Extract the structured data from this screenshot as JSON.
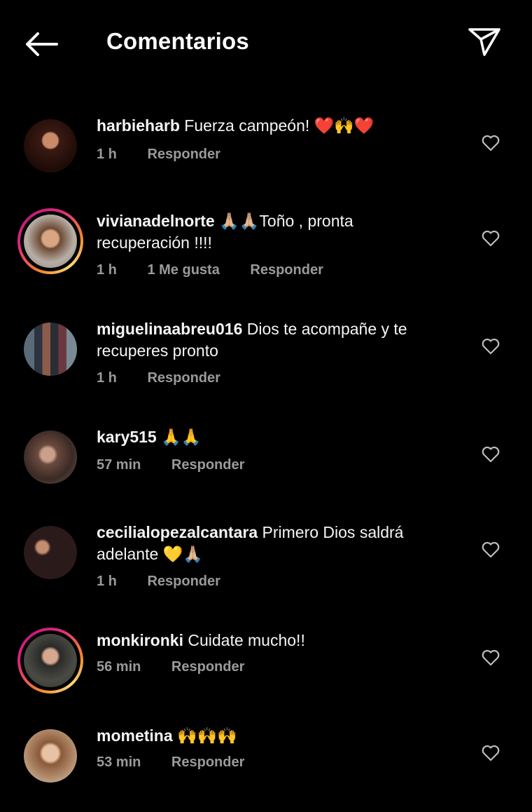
{
  "header": {
    "title": "Comentarios",
    "back_icon": "back-arrow-icon",
    "send_icon": "send-icon"
  },
  "colors": {
    "background": "#000000",
    "meta_text": "#9a9a9a",
    "story_ring": [
      "#f58529",
      "#dd2a7b",
      "#feda75"
    ]
  },
  "comments": [
    {
      "username": "harbieharb",
      "text": "Fuerza campeón! ❤️🙌❤️",
      "time": "1 h",
      "likes": "",
      "reply": "Responder",
      "story_ring": false
    },
    {
      "username": "vivianadelnorte",
      "text": "🙏🏼🙏🏼Toño , pronta recuperación !!!!",
      "time": "1 h",
      "likes": "1 Me gusta",
      "reply": "Responder",
      "story_ring": true
    },
    {
      "username": "miguelinaabreu016",
      "text": "Dios te acompañe y te recuperes pronto",
      "time": "1 h",
      "likes": "",
      "reply": "Responder",
      "story_ring": false
    },
    {
      "username": "kary515",
      "text": "🙏🙏",
      "time": "57 min",
      "likes": "",
      "reply": "Responder",
      "story_ring": false
    },
    {
      "username": "cecilialopezalcantara",
      "text": "Primero Dios saldrá adelante 💛🙏🏼",
      "time": "1 h",
      "likes": "",
      "reply": "Responder",
      "story_ring": false
    },
    {
      "username": "monkironki",
      "text": "Cuidate mucho!!",
      "time": "56 min",
      "likes": "",
      "reply": "Responder",
      "story_ring": true
    },
    {
      "username": "mometina",
      "text": "🙌🙌🙌",
      "time": "53 min",
      "likes": "",
      "reply": "Responder",
      "story_ring": false
    }
  ]
}
